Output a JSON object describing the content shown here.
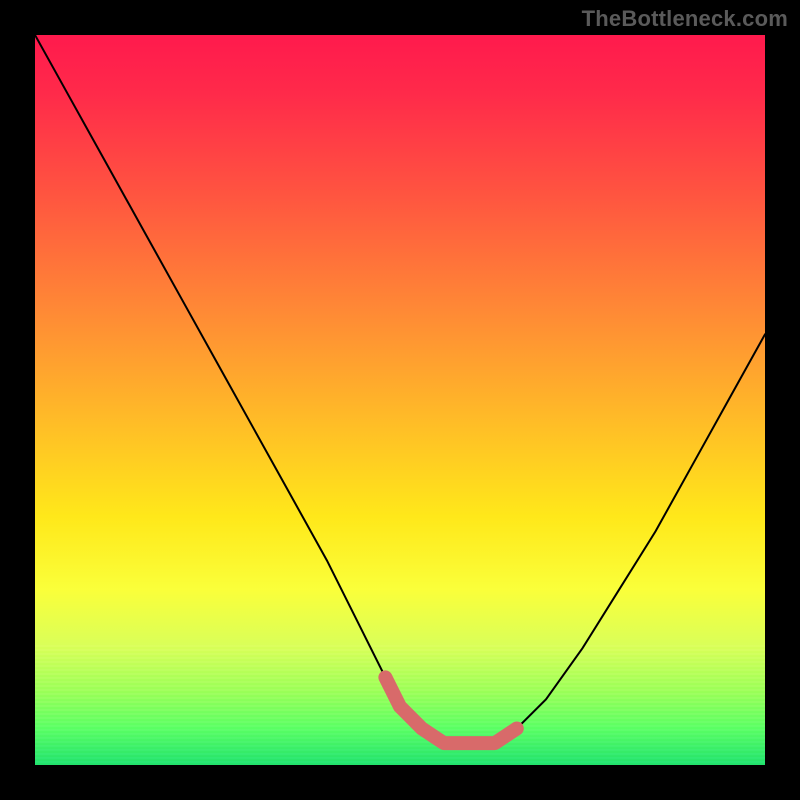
{
  "watermark": "TheBottleneck.com",
  "chart_data": {
    "type": "line",
    "title": "",
    "xlabel": "",
    "ylabel": "",
    "xlim": [
      0,
      100
    ],
    "ylim": [
      0,
      100
    ],
    "grid": false,
    "legend": false,
    "background_gradient": {
      "orientation": "vertical",
      "stops": [
        {
          "pos": 0.0,
          "color": "#ff1a4d"
        },
        {
          "pos": 0.4,
          "color": "#ff8a35"
        },
        {
          "pos": 0.66,
          "color": "#ffe81a"
        },
        {
          "pos": 0.9,
          "color": "#9cff5a"
        },
        {
          "pos": 1.0,
          "color": "#22e36e"
        }
      ]
    },
    "series": [
      {
        "name": "curve",
        "color": "#000000",
        "type": "line",
        "x": [
          0,
          5,
          10,
          15,
          20,
          25,
          30,
          35,
          40,
          45,
          48,
          50,
          53,
          56,
          60,
          63,
          66,
          70,
          75,
          80,
          85,
          90,
          95,
          100
        ],
        "y": [
          100,
          91,
          82,
          73,
          64,
          55,
          46,
          37,
          28,
          18,
          12,
          8,
          5,
          3,
          3,
          3,
          5,
          9,
          16,
          24,
          32,
          41,
          50,
          59
        ]
      },
      {
        "name": "plateau-highlight",
        "color": "#d86a6a",
        "type": "line",
        "stroke_width": 14,
        "x": [
          48,
          50,
          53,
          56,
          60,
          63,
          66
        ],
        "y": [
          12,
          8,
          5,
          3,
          3,
          3,
          5
        ]
      }
    ]
  }
}
